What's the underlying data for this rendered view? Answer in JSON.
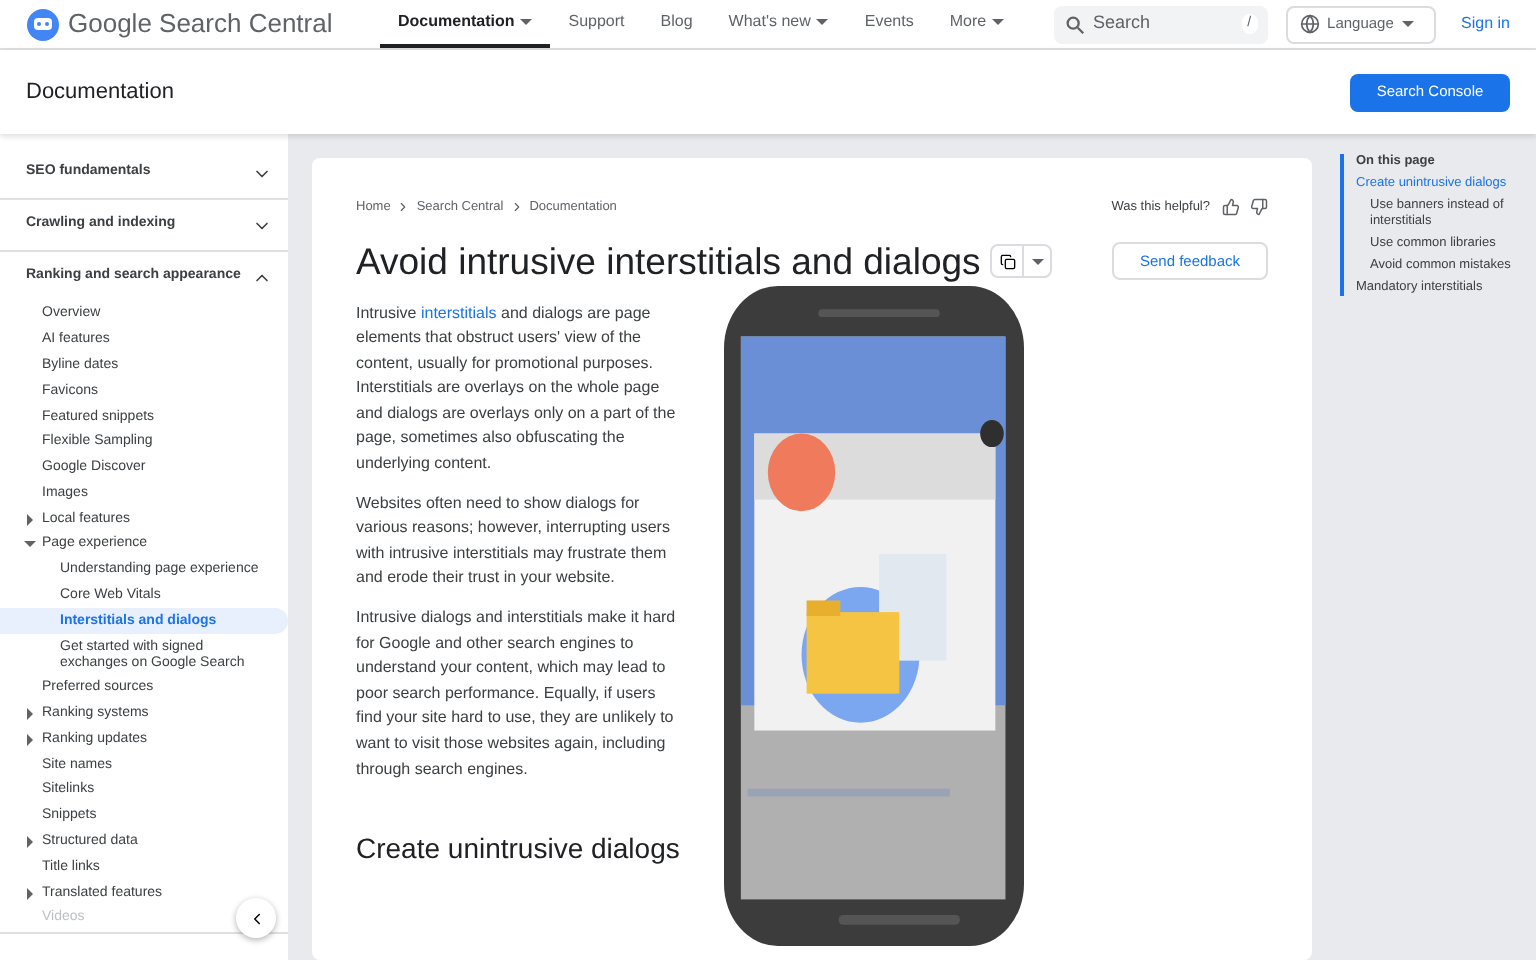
{
  "header": {
    "site_title": "Google Search Central",
    "nav": [
      {
        "label": "Documentation",
        "selected": true,
        "dropdown": true
      },
      {
        "label": "Support",
        "selected": false,
        "dropdown": false
      },
      {
        "label": "Blog",
        "selected": false,
        "dropdown": false
      },
      {
        "label": "What's new",
        "selected": false,
        "dropdown": true
      },
      {
        "label": "Events",
        "selected": false,
        "dropdown": false
      },
      {
        "label": "More",
        "selected": false,
        "dropdown": true
      }
    ],
    "search": {
      "placeholder": "Search",
      "shortcut": "/"
    },
    "language": "Language",
    "sign_in": "Sign in"
  },
  "subheader": {
    "title": "Documentation",
    "button": "Search Console"
  },
  "sidebar": {
    "sections": [
      {
        "label": "SEO fundamentals",
        "expanded": false
      },
      {
        "label": "Crawling and indexing",
        "expanded": false
      },
      {
        "label": "Ranking and search appearance",
        "expanded": true,
        "children": [
          {
            "label": "Overview",
            "selected": false
          },
          {
            "label": "AI features",
            "selected": false
          },
          {
            "label": "Byline dates",
            "selected": false
          },
          {
            "label": "Favicons",
            "selected": false
          },
          {
            "label": "Featured snippets",
            "selected": false
          },
          {
            "label": "Flexible Sampling",
            "selected": false
          },
          {
            "label": "Google Discover",
            "selected": false
          },
          {
            "label": "Images",
            "selected": false
          },
          {
            "label": "Local features",
            "selected": false,
            "expanded": false
          },
          {
            "label": "Page experience",
            "selected": false,
            "expanded": true,
            "children": [
              {
                "label": "Understanding page experience",
                "selected": false
              },
              {
                "label": "Core Web Vitals",
                "selected": false
              },
              {
                "label": "Interstitials and dialogs",
                "selected": true
              },
              {
                "label": "Get started with signed exchanges on Google Search",
                "selected": false
              }
            ]
          },
          {
            "label": "Preferred sources",
            "selected": false
          },
          {
            "label": "Ranking systems",
            "selected": false,
            "expanded": false
          },
          {
            "label": "Ranking updates",
            "selected": false,
            "expanded": false
          },
          {
            "label": "Site names",
            "selected": false
          },
          {
            "label": "Sitelinks",
            "selected": false
          },
          {
            "label": "Snippets",
            "selected": false
          },
          {
            "label": "Structured data",
            "selected": false,
            "expanded": false
          },
          {
            "label": "Title links",
            "selected": false
          },
          {
            "label": "Translated features",
            "selected": false,
            "expanded": false
          },
          {
            "label": "Videos",
            "selected": false,
            "disabled": true
          }
        ]
      }
    ]
  },
  "article": {
    "breadcrumbs": [
      "Home",
      "Search Central",
      "Documentation"
    ],
    "helpful": "Was this helpful?",
    "title": "Avoid intrusive interstitials and dialogs",
    "feedback": "Send feedback",
    "intro": {
      "before": "Intrusive",
      "link": "interstitials",
      "after": "and dialogs are page elements that obstruct users' view of the content, usually for promotional purposes. Interstitials are overlays on the whole page and dialogs are overlays only on a part of the page, sometimes also obfuscating the underlying content."
    },
    "paragraphs": [
      "Websites often need to show dialogs for various reasons; however, interrupting users with intrusive interstitials may frustrate them and erode their trust in your website.",
      "Intrusive dialogs and interstitials make it hard for Google and other search engines to understand your content, which may lead to poor search performance. Equally, if users find your site hard to use, they are unlikely to want to visit those websites again, including through search engines."
    ],
    "subheading": "Create unintrusive dialogs"
  },
  "toc": {
    "heading": "On this page",
    "items": [
      {
        "label": "Create unintrusive dialogs",
        "selected": true,
        "children": [
          {
            "label": "Use banners instead of interstitials",
            "selected": false
          },
          {
            "label": "Use common libraries",
            "selected": false
          },
          {
            "label": "Avoid common mistakes",
            "selected": false
          }
        ]
      },
      {
        "label": "Mandatory interstitials",
        "selected": false
      }
    ]
  }
}
